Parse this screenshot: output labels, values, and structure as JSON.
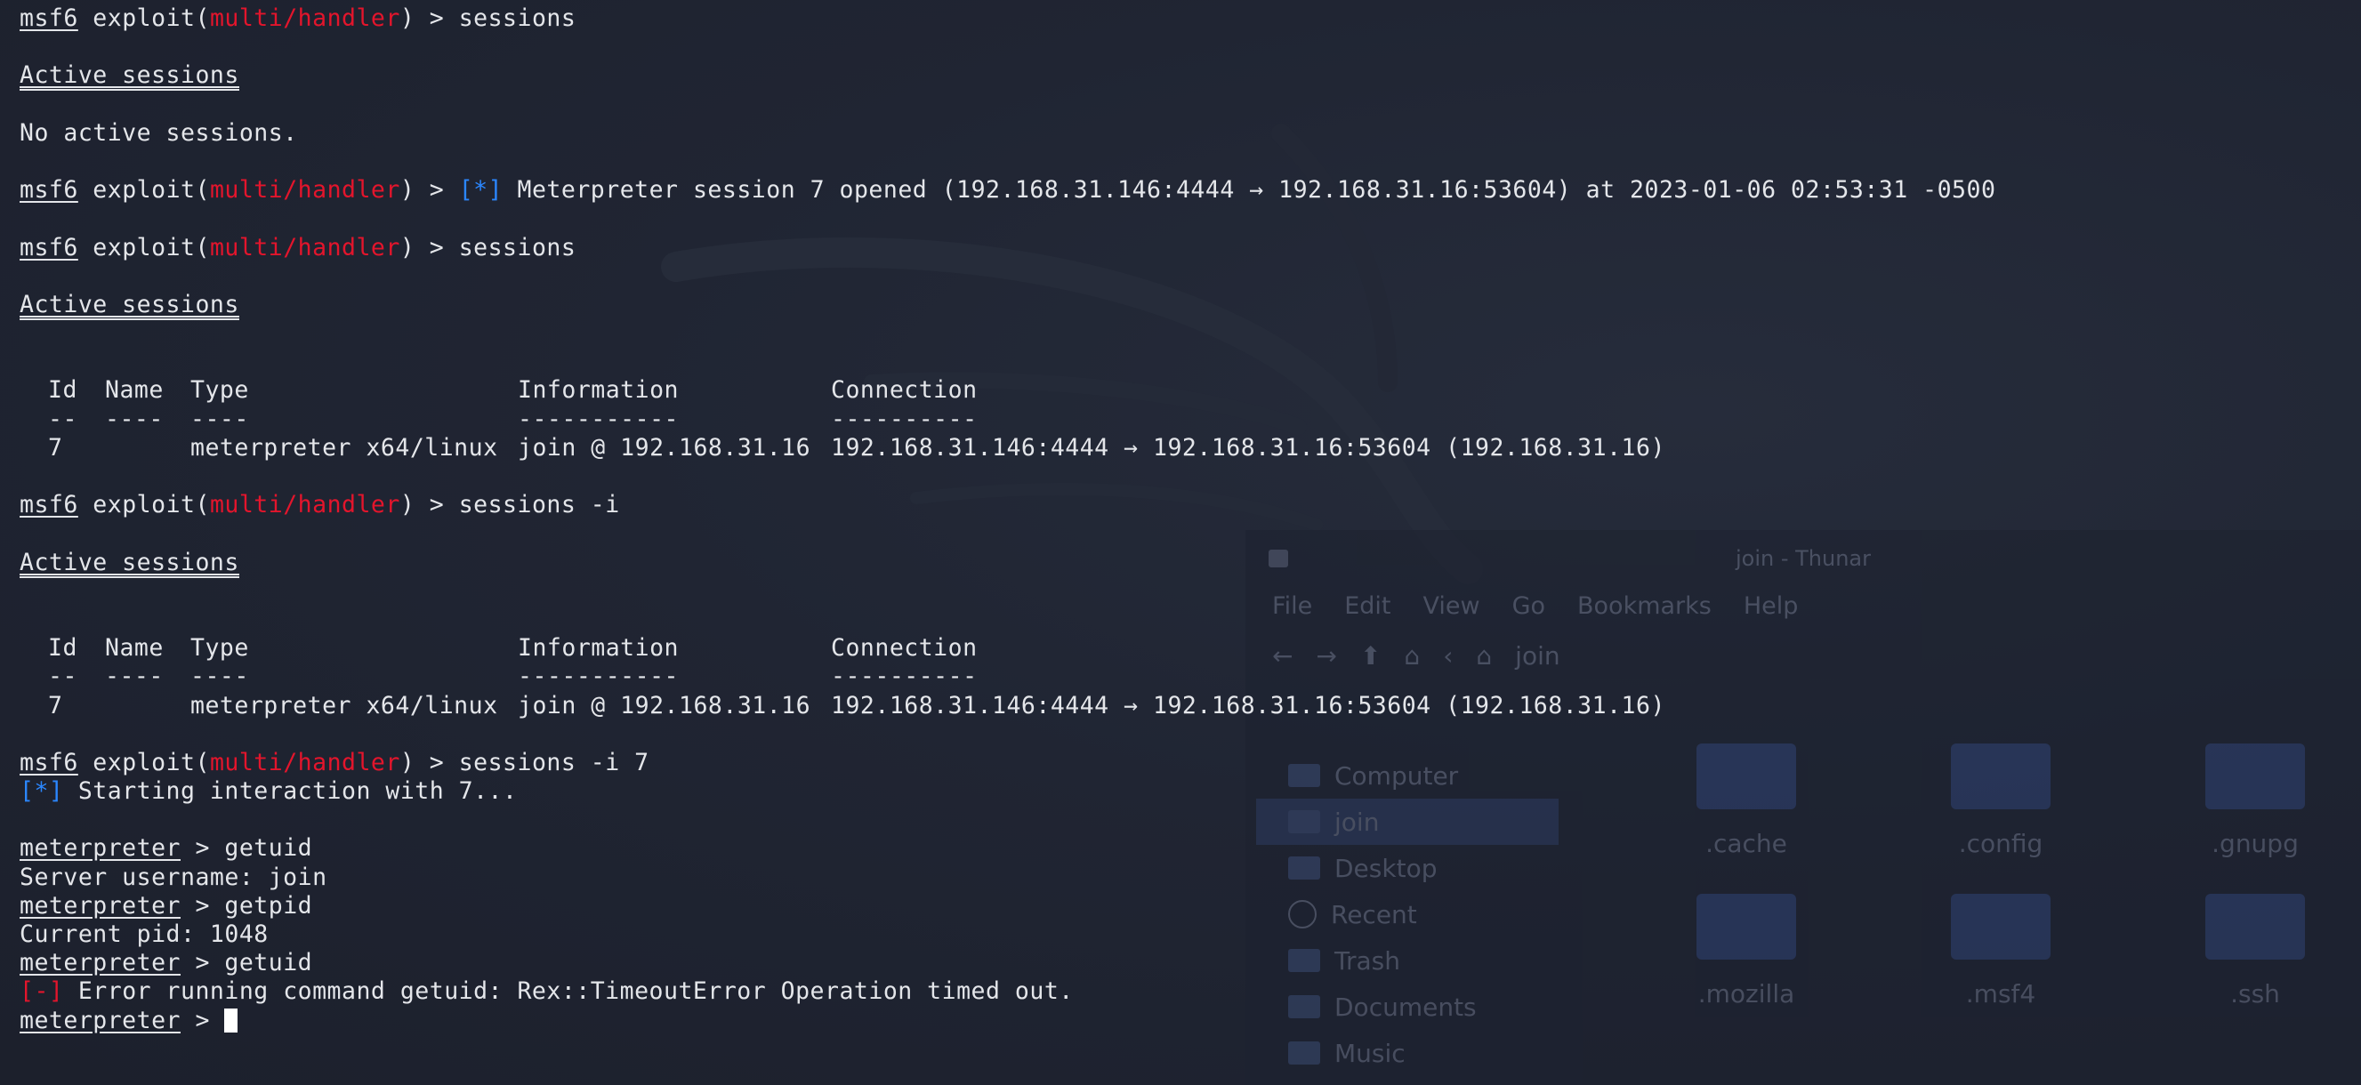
{
  "terminal": {
    "prompt": {
      "msf": "msf6",
      "exploit_word": "exploit(",
      "module": "multi/handler",
      "tail": ") > "
    },
    "cmd1": "sessions",
    "active_sessions_heading": "Active sessions",
    "no_sessions": "No active sessions.",
    "star_tag": "[*]",
    "session_opened": " Meterpreter session 7 opened (192.168.31.146:4444 → 192.168.31.16:53604) at 2023-01-06 02:53:31 -0500",
    "cmd2": "sessions",
    "table": {
      "headers": [
        "Id",
        "Name",
        "Type",
        "Information",
        "Connection"
      ],
      "underlines": [
        "--",
        "----",
        "----",
        "-----------",
        "----------"
      ],
      "row": [
        "7",
        "",
        "meterpreter x64/linux",
        "join @ 192.168.31.16",
        "192.168.31.146:4444 → 192.168.31.16:53604 (192.168.31.16)"
      ]
    },
    "cmd3": "sessions -i",
    "cmd4": "sessions -i 7",
    "starting": " Starting interaction with 7...",
    "met_prompt": "meterpreter",
    "met_tail": " > ",
    "met_cmd1": "getuid",
    "server_username": "Server username: join",
    "met_cmd2": "getpid",
    "current_pid": "Current pid: 1048",
    "met_cmd3": "getuid",
    "err_tag": "[-]",
    "error_text": " Error running command getuid: Rex::TimeoutError Operation timed out."
  },
  "file_manager": {
    "title": "join - Thunar",
    "menu": [
      "File",
      "Edit",
      "View",
      "Go",
      "Bookmarks",
      "Help"
    ],
    "location": "join",
    "sidebar": [
      "Computer",
      "join",
      "Desktop",
      "Recent",
      "Trash",
      "Documents",
      "Music"
    ],
    "files": [
      ".cache",
      ".config",
      ".gnupg",
      ".mozilla",
      ".msf4",
      ".ssh"
    ]
  }
}
